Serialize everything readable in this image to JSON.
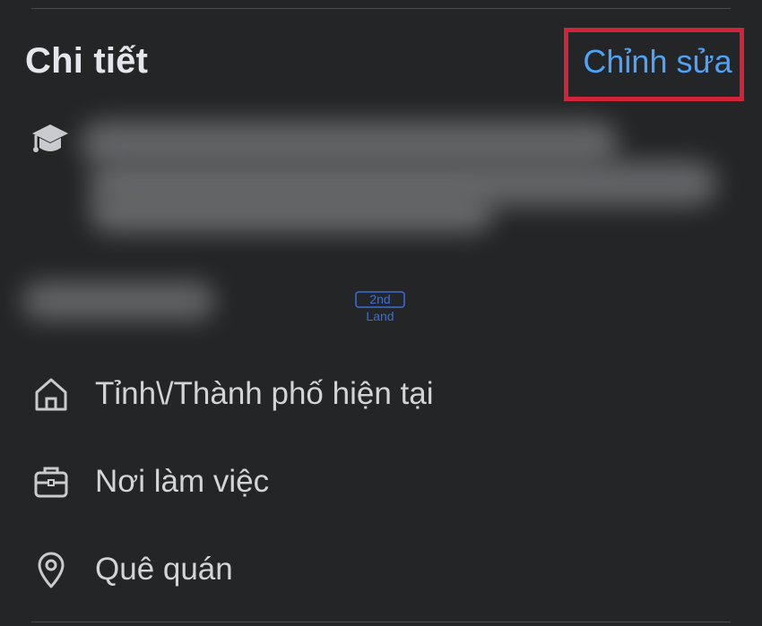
{
  "header": {
    "title": "Chi tiết",
    "edit_label": "Chỉnh sửa"
  },
  "watermark": {
    "line1": "2nd",
    "line2": "Land"
  },
  "details": [
    {
      "icon": "home-icon",
      "label": "Tỉnh\\/Thành phố hiện tại"
    },
    {
      "icon": "briefcase-icon",
      "label": "Nơi làm việc"
    },
    {
      "icon": "location-pin-icon",
      "label": "Quê quán"
    }
  ],
  "colors": {
    "background": "#242526",
    "accent": "#4fa3f7",
    "highlight_box": "#d32338",
    "text": "#e4e6eb"
  }
}
